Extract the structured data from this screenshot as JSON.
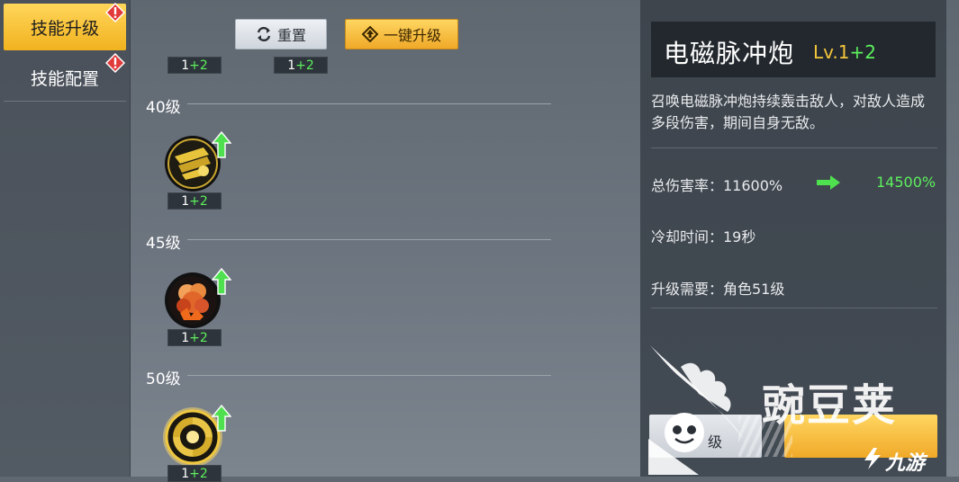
{
  "sidebar": {
    "tabs": [
      {
        "label": "技能升级",
        "active": true,
        "alert": true
      },
      {
        "label": "技能配置",
        "active": false,
        "alert": true
      }
    ]
  },
  "toolbar": {
    "reset_label": "重置",
    "one_click_upgrade_label": "一键升级"
  },
  "top_badges": [
    {
      "base": "1",
      "plus": "+2"
    },
    {
      "base": "1",
      "plus": "+2"
    }
  ],
  "tiers": [
    {
      "level_label": "40级",
      "badge_base": "1",
      "badge_plus": "+2",
      "icon": "electromagnetic-cannon-icon"
    },
    {
      "level_label": "45级",
      "badge_base": "1",
      "badge_plus": "+2",
      "icon": "explosion-skill-icon"
    },
    {
      "level_label": "50级",
      "badge_base": "1",
      "badge_plus": "+2",
      "icon": "vortex-skill-icon"
    }
  ],
  "detail": {
    "name": "电磁脉冲炮",
    "level": "Lv.1",
    "level_plus": "+2",
    "description": "召唤电磁脉冲炮持续轰击敌人，对敌人造成多段伤害，期间自身无敌。",
    "damage_label": "总伤害率：11600%",
    "damage_new": "14500%",
    "cooldown_label": "冷却时间：19秒",
    "requirement_label": "升级需要：角色51级",
    "bottom_left_partial": "级"
  },
  "watermark": {
    "text": "豌豆荚",
    "brand": "九游"
  },
  "colors": {
    "accent_gold": "#f1b21f",
    "plus_green": "#5df05d",
    "level_gold": "#f4c63b",
    "alert_red": "#e23a3a"
  }
}
